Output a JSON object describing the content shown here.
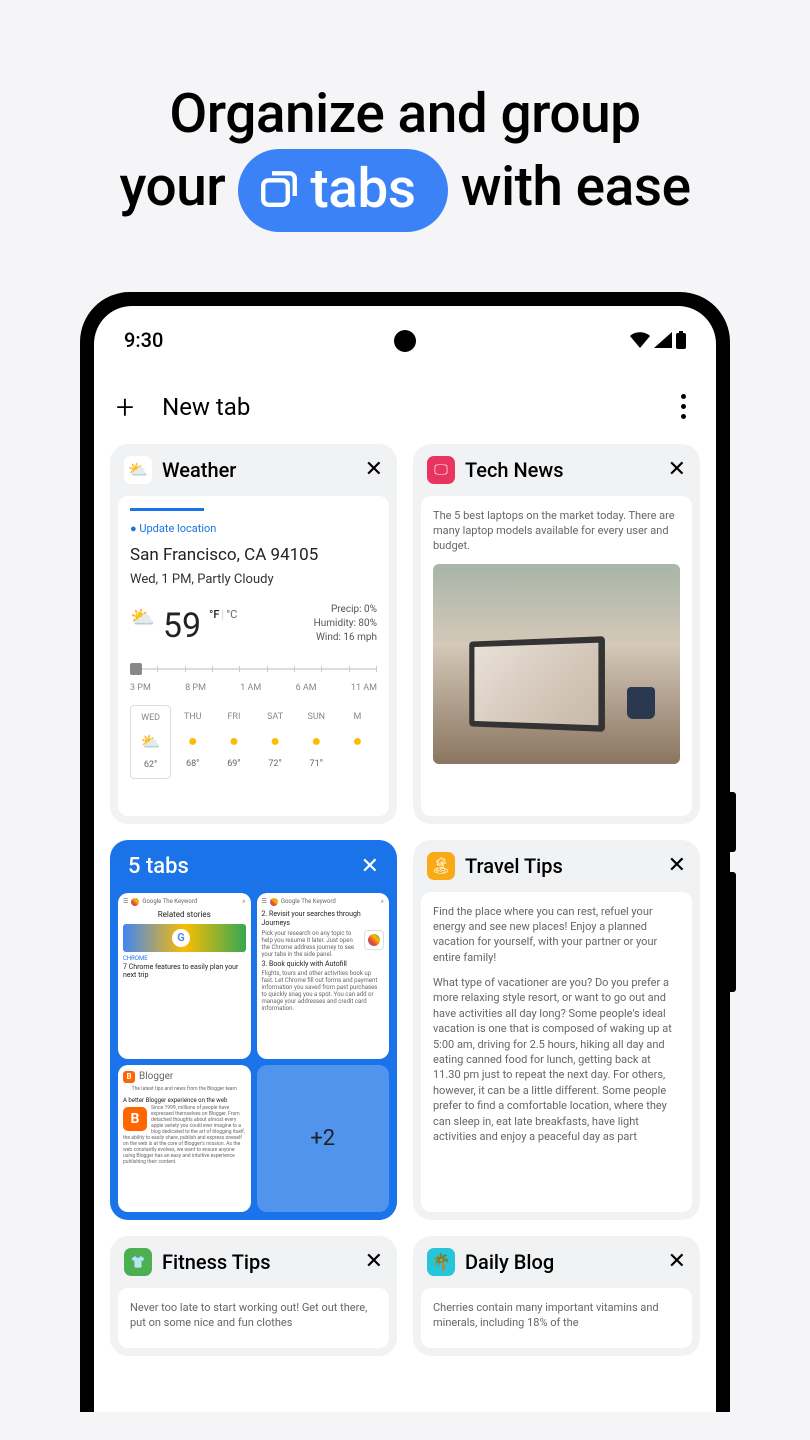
{
  "headline": {
    "line1": "Organize and group",
    "your": "your",
    "tabs": "tabs",
    "ease": "with ease"
  },
  "status": {
    "time": "9:30"
  },
  "appbar": {
    "title": "New tab"
  },
  "weather": {
    "title": "Weather",
    "update": "Update location",
    "location": "San Francisco, CA 94105",
    "time": "Wed, 1 PM, Partly Cloudy",
    "temp": "59",
    "unit_f": "°F",
    "unit_c": "°C",
    "precip": "Precip: 0%",
    "humidity": "Humidity: 80%",
    "wind": "Wind: 16 mph",
    "times": [
      "3 PM",
      "8 PM",
      "1 AM",
      "6 AM",
      "11 AM"
    ],
    "days": [
      {
        "name": "WED",
        "temp": "62°",
        "cloudy": true
      },
      {
        "name": "THU",
        "temp": "68°"
      },
      {
        "name": "FRI",
        "temp": "69°"
      },
      {
        "name": "SAT",
        "temp": "72°"
      },
      {
        "name": "SUN",
        "temp": "71°"
      },
      {
        "name": "M",
        "temp": ""
      }
    ]
  },
  "tech": {
    "title": "Tech News",
    "body": "The 5 best laptops on the market today. There are many laptop models available for every user and budget."
  },
  "tabgroup": {
    "title": "5 tabs",
    "more": "+2",
    "mini1": {
      "bar": "Google  The Keyword",
      "headline": "Related stories",
      "label": "CHROME",
      "text": "7 Chrome features to easily plan your next trip"
    },
    "mini2": {
      "bar": "Google  The Keyword",
      "h2": "2. Revisit your searches through Journeys",
      "h3": "3. Book quickly with Autofill",
      "text1": "Pick your research on any topic to help you resume it later. Just open the Chrome address journey to see your tabs in the side panel.",
      "text2": "Flights, tours and other activities book up fast. Let Chrome fill out forms and payment information you saved from past purchases to quickly snag you a spot. You can add or manage your addresses and credit card information."
    },
    "mini3": {
      "title": "Blogger",
      "sub": "The latest tips and news from the Blogger team",
      "bold": "A better Blogger experience on the web",
      "text": "Since 1999, millions of people have expressed themselves on Blogger. From detached thoughts about almost every apple variety you could ever imagine to a blog dedicated to the art of blogging itself, the ability to easily share, publish and express oneself on the web is at the core of Blogger's mission. As the web constantly evolves, we want to ensure anyone using Blogger has an easy and intuitive experience publishing their content."
    }
  },
  "travel": {
    "title": "Travel Tips",
    "p1": "Find the place where you can rest, refuel your energy and see new places! Enjoy a planned vacation for yourself, with your partner or your entire family!",
    "p2": "What type of vacationer are you? Do you prefer a more relaxing style resort, or want to go out and have activities all day long? Some people's ideal vacation is one that is composed of waking up at 5:00 am, driving for 2.5 hours, hiking all day and eating canned food for lunch, getting back at 11.30 pm just to repeat the next day. For others, however, it can be a little different. Some people prefer to find a comfortable location, where they can sleep in, eat late breakfasts, have light activities and enjoy a peaceful day as part"
  },
  "fitness": {
    "title": "Fitness Tips",
    "body": "Never too late to start working out! Get out there, put on some nice and fun clothes"
  },
  "blog": {
    "title": "Daily Blog",
    "body": "Cherries contain many important vitamins and minerals, including 18% of the"
  }
}
